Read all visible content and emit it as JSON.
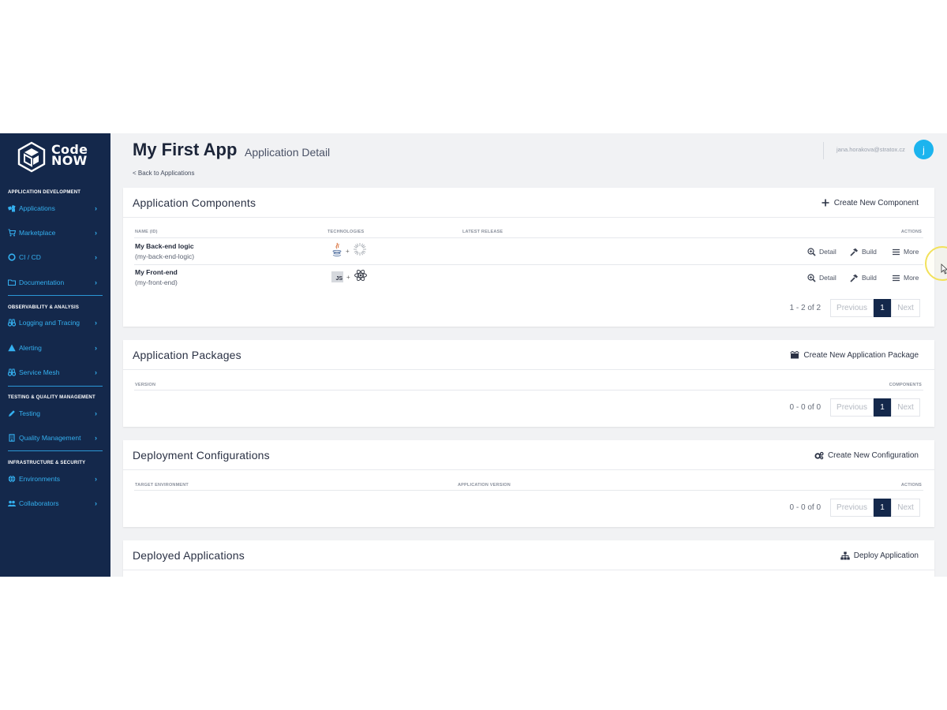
{
  "sidebar": {
    "logo_line1": "Code",
    "logo_line2": "NOW",
    "sections": [
      "APPLICATION DEVELOPMENT",
      "OBSERVABILITY & ANALYSIS",
      "TESTING & QUALITY MANAGEMENT",
      "INFRASTRUCTURE & SECURITY"
    ],
    "items": [
      {
        "label": "Applications",
        "icon": "cubes-icon"
      },
      {
        "label": "Marketplace",
        "icon": "cart-icon"
      },
      {
        "label": "CI / CD",
        "icon": "cycle-icon"
      },
      {
        "label": "Documentation",
        "icon": "folder-icon"
      },
      {
        "label": "Logging and Tracing",
        "icon": "binoculars-icon"
      },
      {
        "label": "Alerting",
        "icon": "warning-icon"
      },
      {
        "label": "Service Mesh",
        "icon": "binoculars-icon"
      },
      {
        "label": "Testing",
        "icon": "pen-icon"
      },
      {
        "label": "Quality Management",
        "icon": "building-icon"
      },
      {
        "label": "Environments",
        "icon": "globe-icon"
      },
      {
        "label": "Collaborators",
        "icon": "users-icon"
      }
    ]
  },
  "header": {
    "title": "My First App",
    "subtitle": "Application Detail",
    "back_link": "< Back to Applications",
    "user_email": "jana.horakova@stratox.cz",
    "avatar_letter": "j"
  },
  "components": {
    "title": "Application Components",
    "action": "Create New Component",
    "columns": [
      "NAME (ID)",
      "TECHNOLOGIES",
      "LATEST RELEASE",
      "ACTIONS"
    ],
    "rows": [
      {
        "name": "My Back-end logic",
        "id": "(my-back-end-logic)",
        "tech": [
          "java-icon",
          "spring-icon"
        ]
      },
      {
        "name": "My Front-end",
        "id": "(my-front-end)",
        "tech": [
          "js-icon",
          "react-icon"
        ]
      }
    ],
    "row_actions": {
      "detail": "Detail",
      "build": "Build",
      "more": "More"
    },
    "tech_plus": "+",
    "js_badge": "JS",
    "pager": {
      "count": "1 - 2 of 2",
      "prev": "Previous",
      "page": "1",
      "next": "Next"
    }
  },
  "packages": {
    "title": "Application Packages",
    "action": "Create New Application Package",
    "columns": [
      "VERSION",
      "COMPONENTS"
    ],
    "pager": {
      "count": "0 - 0 of 0",
      "prev": "Previous",
      "page": "1",
      "next": "Next"
    }
  },
  "deployments": {
    "title": "Deployment Configurations",
    "action": "Create New Configuration",
    "columns": [
      "TARGET ENVIRONMENT",
      "APPLICATION VERSION",
      "ACTIONS"
    ],
    "pager": {
      "count": "0 - 0 of 0",
      "prev": "Previous",
      "page": "1",
      "next": "Next"
    }
  },
  "deployed": {
    "title": "Deployed Applications",
    "action": "Deploy Application"
  },
  "colors": {
    "sidebar_bg": "#14284b",
    "sidebar_link": "#34b0f0",
    "accent": "#1cb4ee",
    "page_bg": "#f1f2f4"
  }
}
